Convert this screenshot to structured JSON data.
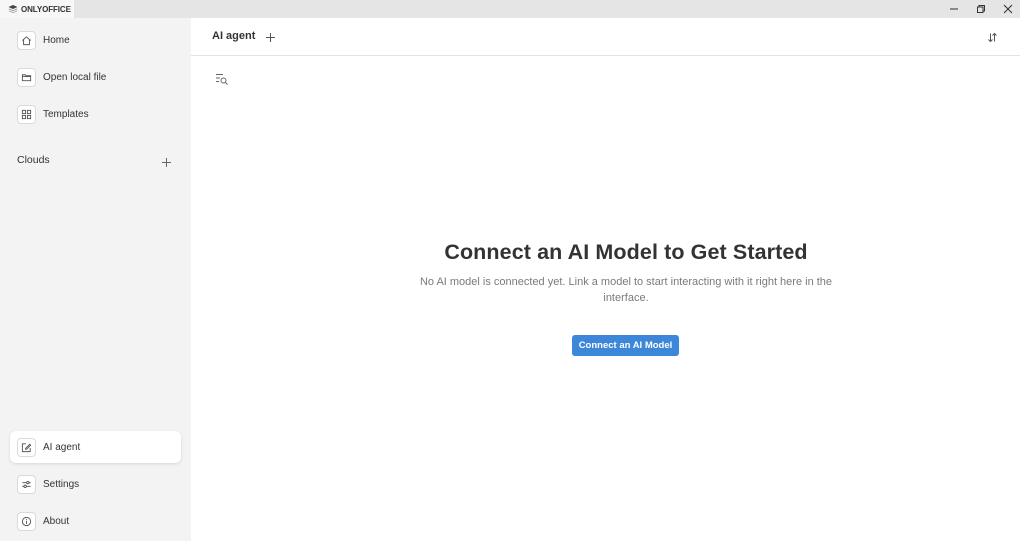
{
  "window": {
    "app_name": "ONLYOFFICE",
    "controls": [
      "minimize-icon",
      "restore-icon",
      "close-icon"
    ]
  },
  "sidebar": {
    "items": [
      {
        "label": "Home",
        "icon": "home-icon"
      },
      {
        "label": "Open local file",
        "icon": "folder-icon"
      },
      {
        "label": "Templates",
        "icon": "grid-icon"
      }
    ],
    "clouds_label": "Clouds",
    "bottom_items": [
      {
        "label": "AI agent",
        "icon": "ai-edit-icon",
        "active": true
      },
      {
        "label": "Settings",
        "icon": "sliders-icon"
      },
      {
        "label": "About",
        "icon": "info-icon"
      }
    ]
  },
  "main": {
    "tab_title": "AI agent",
    "empty_state": {
      "title": "Connect an AI Model to Get Started",
      "description": "No AI model is connected yet. Link a model to start interacting with it right here in the interface.",
      "button_label": "Connect an AI Model"
    }
  },
  "colors": {
    "accent": "#3d87da",
    "sidebar_bg": "#f3f3f3",
    "titlebar_bg": "#e5e5e5"
  }
}
